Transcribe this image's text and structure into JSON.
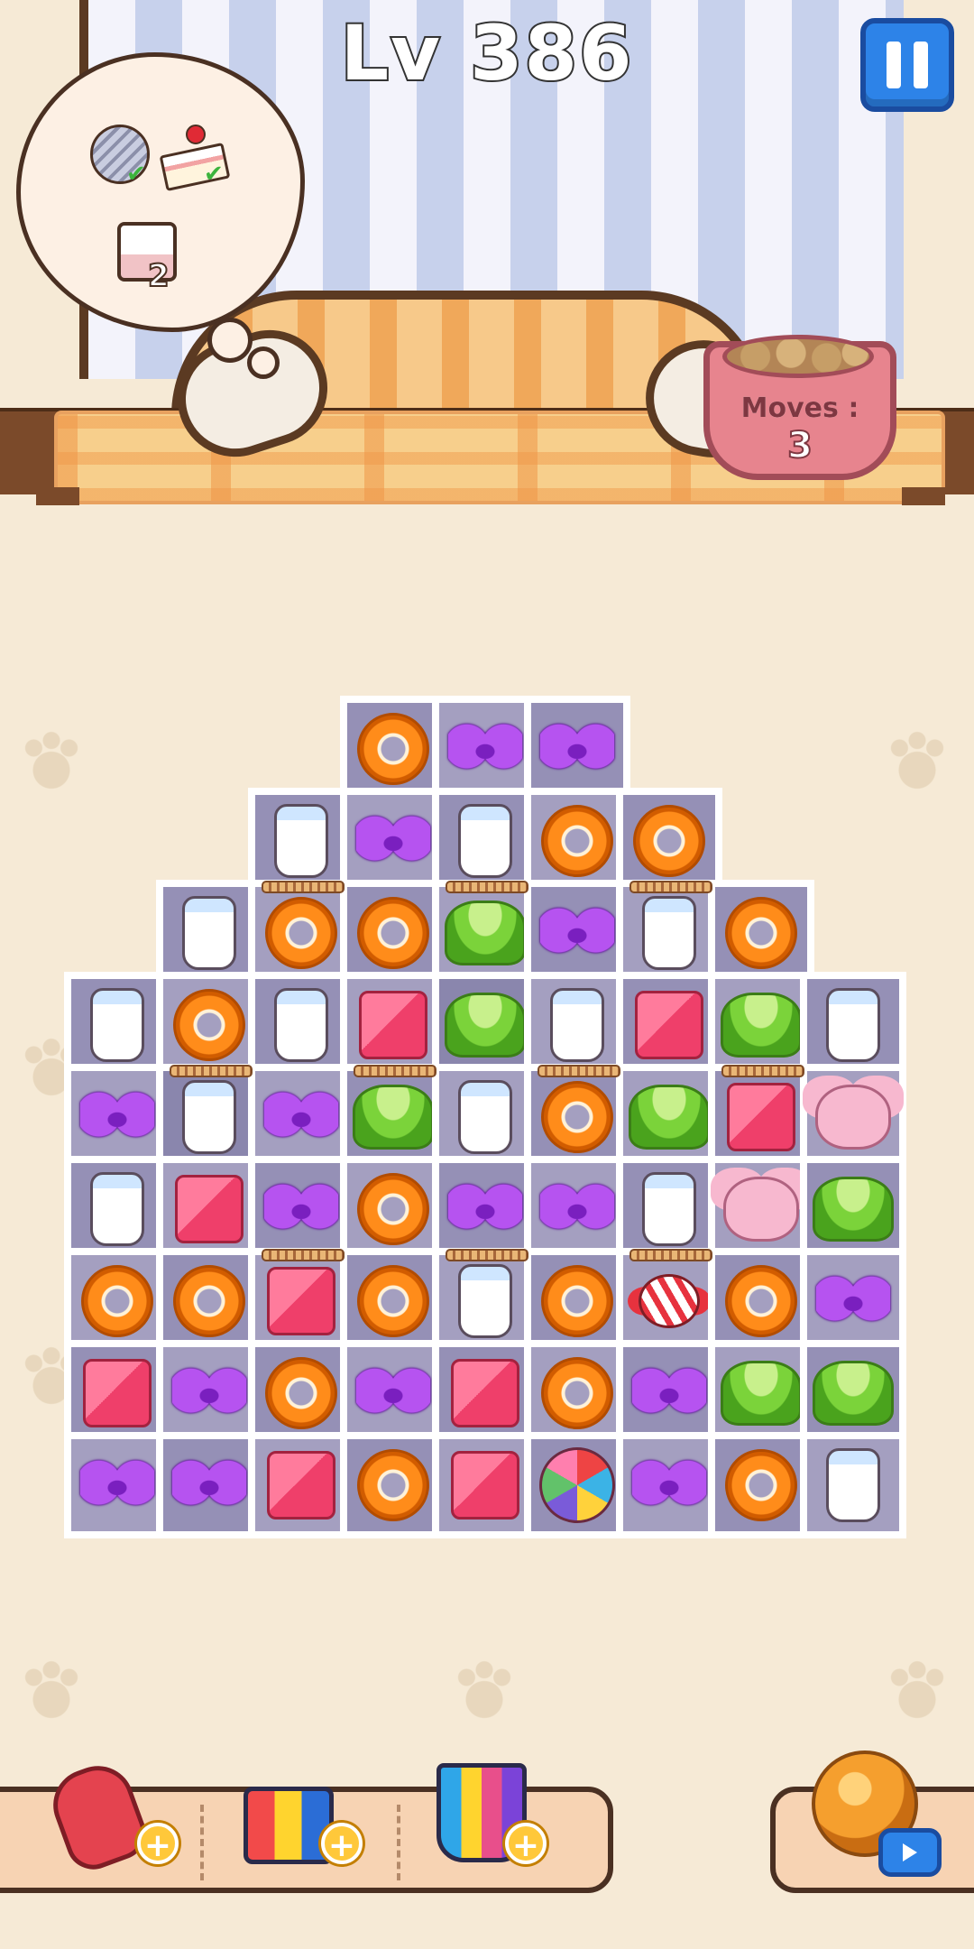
{
  "header": {
    "level_label": "Lv 386"
  },
  "moves": {
    "label": "Moves :",
    "value": "3"
  },
  "goals": [
    {
      "icon": "yarn-ball-icon",
      "completed": true
    },
    {
      "icon": "cake-slice-icon",
      "completed": true
    },
    {
      "icon": "cup-icon",
      "remaining": "2"
    }
  ],
  "board": {
    "rows": [
      [
        "",
        "",
        "",
        "donut",
        "bow",
        "bow",
        "",
        "",
        ""
      ],
      [
        "",
        "",
        "milk",
        "bow",
        "milk",
        "donut",
        "donut",
        "",
        ""
      ],
      [
        "",
        "milk",
        "donut",
        "donut",
        "jelly",
        "bow",
        "milk",
        "donut",
        ""
      ],
      [
        "milk",
        "donut",
        "milk",
        "box",
        "jelly",
        "milk",
        "box",
        "jelly",
        "milk"
      ],
      [
        "bow",
        "milk",
        "bow",
        "jelly",
        "milk",
        "donut",
        "jelly",
        "box",
        "mouse"
      ],
      [
        "milk",
        "box",
        "bow",
        "donut",
        "bow",
        "bow",
        "milk",
        "mouse",
        "jelly"
      ],
      [
        "donut",
        "donut",
        "box",
        "donut",
        "milk",
        "donut",
        "candy",
        "donut",
        "bow"
      ],
      [
        "box",
        "bow",
        "donut",
        "bow",
        "box",
        "donut",
        "bow",
        "jelly",
        "jelly"
      ],
      [
        "bow",
        "bow",
        "box",
        "donut",
        "box",
        "yarn",
        "bow",
        "donut",
        "milk"
      ]
    ],
    "highlighted_cells": [
      [
        3,
        4
      ],
      [
        4,
        1
      ]
    ],
    "bars_below": [
      [
        1,
        2
      ],
      [
        1,
        4
      ],
      [
        1,
        6
      ],
      [
        3,
        1
      ],
      [
        3,
        3
      ],
      [
        3,
        5
      ],
      [
        3,
        7
      ],
      [
        5,
        2
      ],
      [
        5,
        4
      ],
      [
        5,
        6
      ]
    ]
  },
  "boosters": [
    {
      "name": "paw-booster",
      "icon": "paw-hammer-icon",
      "add_label": "+"
    },
    {
      "name": "roller-booster",
      "icon": "paint-roller-icon",
      "add_label": "+"
    },
    {
      "name": "brush-booster",
      "icon": "paint-brush-icon",
      "add_label": "+"
    },
    {
      "name": "shuffle-booster",
      "icon": "shuffle-icon",
      "video": true
    }
  ],
  "colors": {
    "pause_button": "#2d83e8",
    "board_cell": "#a49fc0",
    "background": "#f6ead6"
  }
}
